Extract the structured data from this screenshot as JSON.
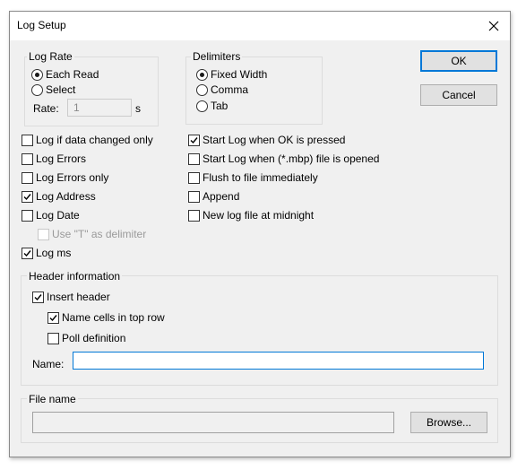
{
  "window": {
    "title": "Log Setup"
  },
  "log_rate": {
    "label": "Log Rate",
    "options": [
      "Each Read",
      "Select"
    ],
    "selected": "Each Read",
    "rate_label": "Rate:",
    "rate_value": "1",
    "rate_unit": "s"
  },
  "delimiters": {
    "label": "Delimiters",
    "options": [
      "Fixed Width",
      "Comma",
      "Tab"
    ],
    "selected": "Fixed Width"
  },
  "buttons": {
    "ok": "OK",
    "cancel": "Cancel",
    "browse": "Browse..."
  },
  "left_options": {
    "data_changed": "Log if data changed only",
    "log_errors": "Log Errors",
    "log_errors_only": "Log Errors only",
    "log_address": "Log Address",
    "log_date": "Log Date",
    "use_t": "Use \"T\" as delimiter",
    "log_ms": "Log ms"
  },
  "right_options": {
    "start_ok": "Start Log when OK is pressed",
    "start_mbp": "Start Log when (*.mbp) file is opened",
    "flush": "Flush to file immediately",
    "append": "Append",
    "new_log": "New log file at midnight"
  },
  "header_info": {
    "label": "Header information",
    "insert_header": "Insert header",
    "name_cells": "Name cells in top row",
    "poll_definition": "Poll definition",
    "name_label": "Name:",
    "name_value": ""
  },
  "file_name": {
    "label": "File name",
    "value": ""
  },
  "colors": {
    "accent": "#0078d7",
    "dialog_bg": "#f0f0f0"
  }
}
